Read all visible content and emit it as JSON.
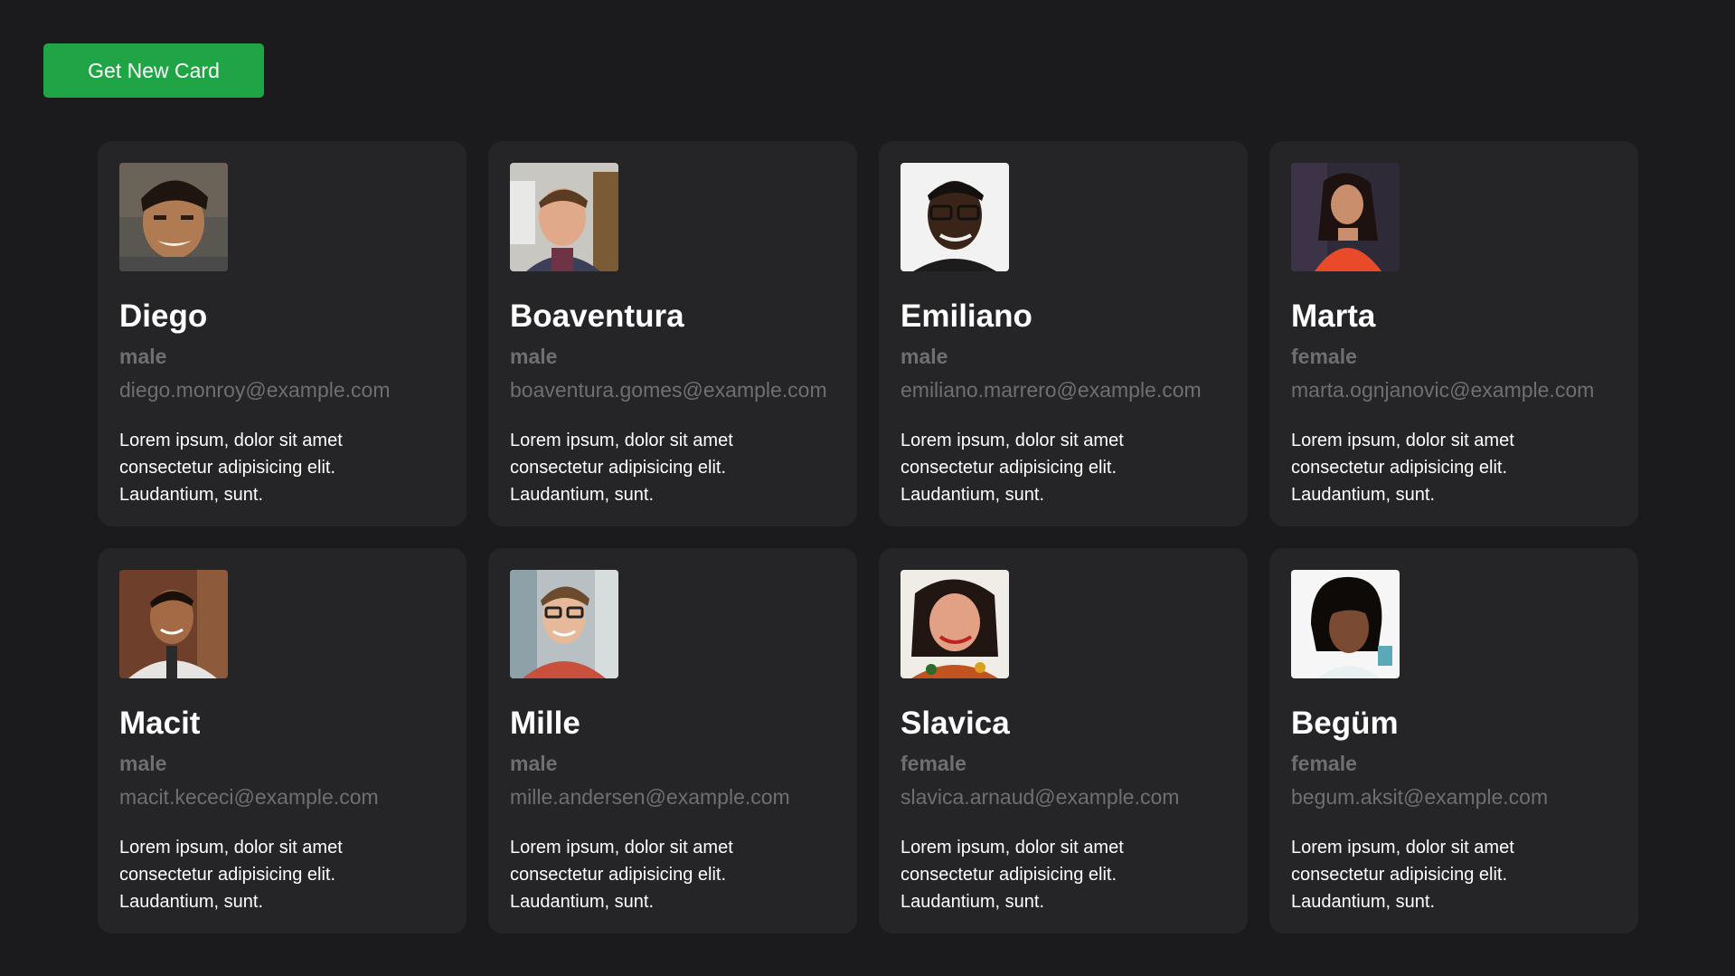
{
  "toolbar": {
    "new_card_label": "Get New Card"
  },
  "colors": {
    "accent": "#1fa545",
    "background": "#1b1b1d",
    "card": "#252527",
    "muted": "#6e6e73"
  },
  "cards": [
    {
      "name": "Diego",
      "gender": "male",
      "email": "diego.monroy@example.com",
      "description": "Lorem ipsum, dolor sit amet consectetur adipisicing elit. Laudantium, sunt."
    },
    {
      "name": "Boaventura",
      "gender": "male",
      "email": "boaventura.gomes@example.com",
      "description": "Lorem ipsum, dolor sit amet consectetur adipisicing elit. Laudantium, sunt."
    },
    {
      "name": "Emiliano",
      "gender": "male",
      "email": "emiliano.marrero@example.com",
      "description": "Lorem ipsum, dolor sit amet consectetur adipisicing elit. Laudantium, sunt."
    },
    {
      "name": "Marta",
      "gender": "female",
      "email": "marta.ognjanovic@example.com",
      "description": "Lorem ipsum, dolor sit amet consectetur adipisicing elit. Laudantium, sunt."
    },
    {
      "name": "Macit",
      "gender": "male",
      "email": "macit.kececi@example.com",
      "description": "Lorem ipsum, dolor sit amet consectetur adipisicing elit. Laudantium, sunt."
    },
    {
      "name": "Mille",
      "gender": "male",
      "email": "mille.andersen@example.com",
      "description": "Lorem ipsum, dolor sit amet consectetur adipisicing elit. Laudantium, sunt."
    },
    {
      "name": "Slavica",
      "gender": "female",
      "email": "slavica.arnaud@example.com",
      "description": "Lorem ipsum, dolor sit amet consectetur adipisicing elit. Laudantium, sunt."
    },
    {
      "name": "Begüm",
      "gender": "female",
      "email": "begum.aksit@example.com",
      "description": "Lorem ipsum, dolor sit amet consectetur adipisicing elit. Laudantium, sunt."
    }
  ]
}
